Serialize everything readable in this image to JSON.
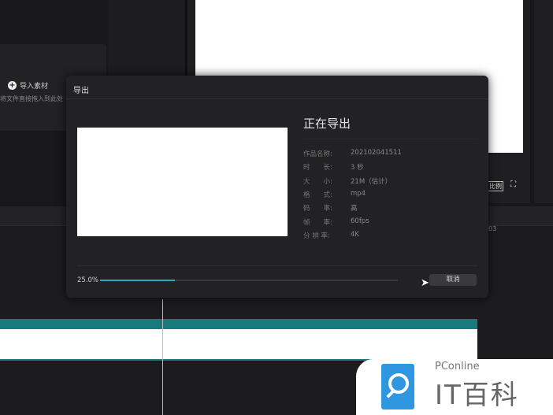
{
  "media": {
    "import_label": "导入素材",
    "hint": "将文件直接拖入到此处"
  },
  "player": {
    "ratio_label": "比例",
    "fullscreen_icon": "fullscreen-icon"
  },
  "timeline": {
    "timecode": "03"
  },
  "dialog": {
    "title": "导出",
    "status": "正在导出",
    "info": [
      {
        "key": "作品名称:",
        "value": "202102041511"
      },
      {
        "key": "时　　长:",
        "value": "3 秒"
      },
      {
        "key": "大　　小:",
        "value": "21M（估计）"
      },
      {
        "key": "格　　式:",
        "value": "mp4"
      },
      {
        "key": "码　　率:",
        "value": "高"
      },
      {
        "key": "帧　　率:",
        "value": "60fps"
      },
      {
        "key": "分 辨 率:",
        "value": "4K"
      }
    ],
    "progress_text": "25.0%",
    "progress": 0.25,
    "cancel_label": "取消",
    "accent": "#2aa7c4"
  },
  "watermark": {
    "brand": "PConline",
    "name": "IT百科"
  }
}
